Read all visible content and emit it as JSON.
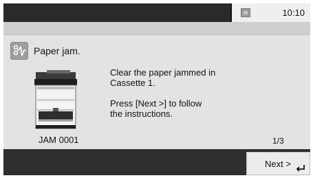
{
  "status_bar": {
    "time": "10:10",
    "icon": "status-icon"
  },
  "message": {
    "icon": "jam-icon",
    "title": "Paper jam.",
    "line1": "Clear the paper jammed in",
    "line2": "Cassette 1.",
    "line3": "Press [Next >] to follow",
    "line4": "the instructions."
  },
  "illustration": {
    "icon": "printer-icon"
  },
  "jam_code": "JAM 0001",
  "page_indicator": "1/3",
  "next_button": {
    "label": "Next >",
    "icon": "enter-icon"
  }
}
